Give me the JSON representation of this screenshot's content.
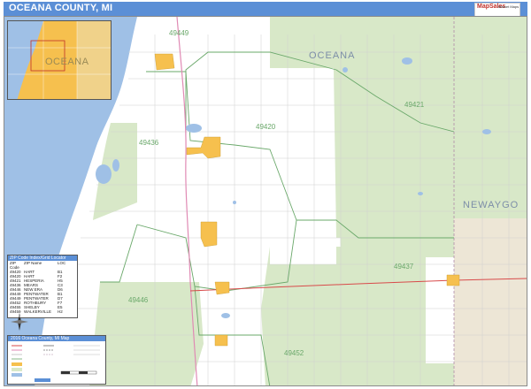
{
  "header": {
    "title": "OCEANA COUNTY, MI",
    "accent": "#5b8fd6",
    "logo": {
      "wordmark": "MapSales",
      "tagline": "Market Maps"
    }
  },
  "map": {
    "county_labels": [
      "OCEANA",
      "NEWAYGO"
    ],
    "zip_labels": [
      "49436",
      "49420",
      "49421",
      "49446",
      "49452",
      "49449",
      "49437"
    ],
    "colors": {
      "land": "#ffffff",
      "water": "#9fc0e6",
      "park": "#d8e8c8",
      "urban": "#f6c04e",
      "zip_boundary": "#6aa86a",
      "highway": "#d84a4a",
      "road": "#bdbdbd",
      "outside_county": "#ede6d6"
    }
  },
  "inset": {
    "label": "OCEANA"
  },
  "zip_index": {
    "title": "ZIP Code Index/Grid Locator",
    "columns": [
      "ZIP Code",
      "ZIP Name",
      "LOC"
    ],
    "rows": [
      [
        "49420",
        "HART",
        "B1"
      ],
      [
        "49420",
        "HART",
        "F2"
      ],
      [
        "49421",
        "HESPERIA",
        "H5"
      ],
      [
        "49436",
        "MEARS",
        "C3"
      ],
      [
        "49446",
        "NEW ERA",
        "D6"
      ],
      [
        "49449",
        "PENTWATER",
        "B1"
      ],
      [
        "49449",
        "PENTWATER",
        "D7"
      ],
      [
        "49452",
        "ROTHBURY",
        "F7"
      ],
      [
        "49455",
        "SHELBY",
        "E5"
      ],
      [
        "49459",
        "WALKERVILLE",
        "H2"
      ]
    ]
  },
  "compass": {
    "label": "N"
  },
  "legend": {
    "title": "2016 Oceana County, MI Map"
  }
}
